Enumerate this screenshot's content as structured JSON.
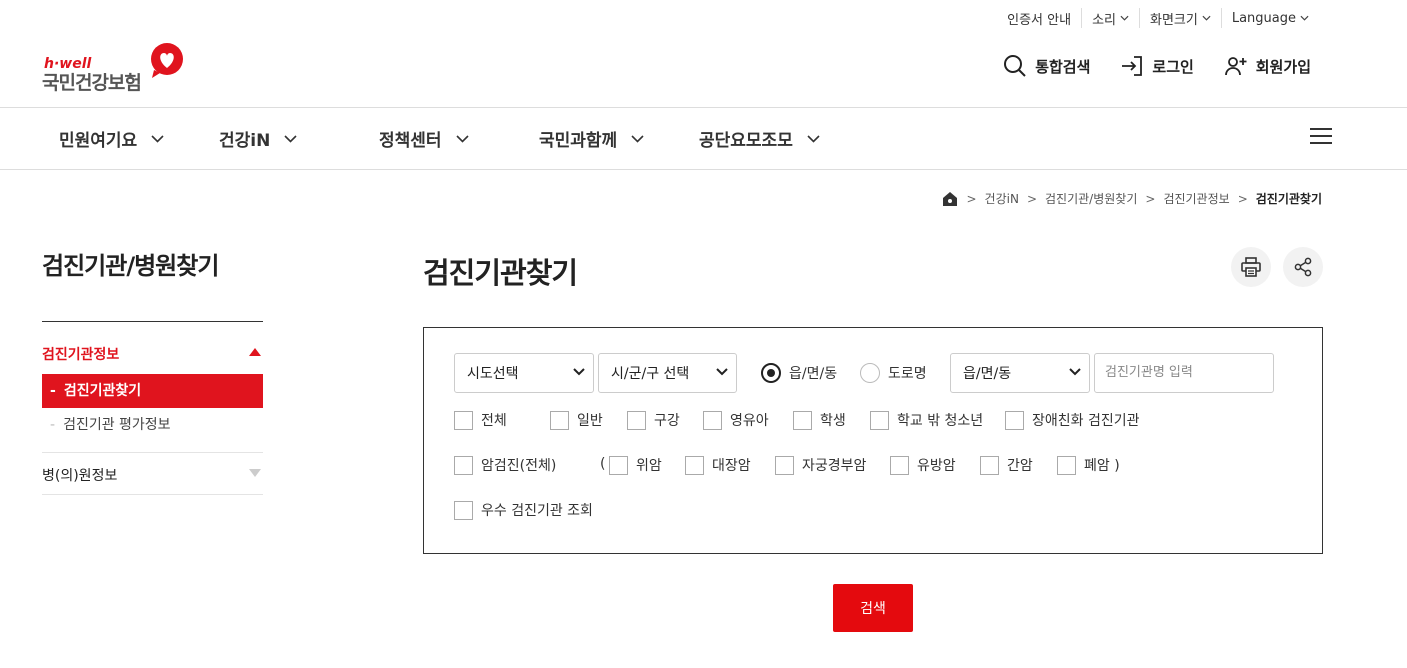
{
  "util": {
    "cert": "인증서 안내",
    "sound": "소리",
    "screen": "화면크기",
    "language": "Language"
  },
  "logo": {
    "brand": "h·well",
    "name": "국민건강보험"
  },
  "actions": {
    "search": "통합검색",
    "login": "로그인",
    "join": "회원가입"
  },
  "gnb": [
    "민원여기요",
    "건강iN",
    "정책센터",
    "국민과함께",
    "공단요모조모"
  ],
  "breadcrumb": [
    "건강iN",
    "검진기관/병원찾기",
    "검진기관정보",
    "검진기관찾기"
  ],
  "lnb": {
    "title": "검진기관/병원찾기",
    "group1": "검진기관정보",
    "sub_active": "검진기관찾기",
    "sub_other": "검진기관 평가정보",
    "group2": "병(의)원정보"
  },
  "content": {
    "title": "검진기관찾기"
  },
  "form": {
    "sido": "시도선택",
    "sigungu": "시/군/구 선택",
    "radio1": "읍/면/동",
    "radio2": "도로명",
    "dong": "읍/면/동",
    "name_placeholder": "검진기관명 입력",
    "checks_row1": [
      "전체",
      "일반",
      "구강",
      "영유아",
      "학생",
      "학교 밖 청소년",
      "장애친화 검진기관"
    ],
    "cancer_all": "암검진(전체)",
    "open_paren": "(",
    "cancers": [
      "위암",
      "대장암",
      "자궁경부암",
      "유방암",
      "간암",
      "폐암 )"
    ],
    "excellent": "우수 검진기관 조회",
    "search_button": "검색"
  },
  "colors": {
    "accent": "#e0141e"
  }
}
